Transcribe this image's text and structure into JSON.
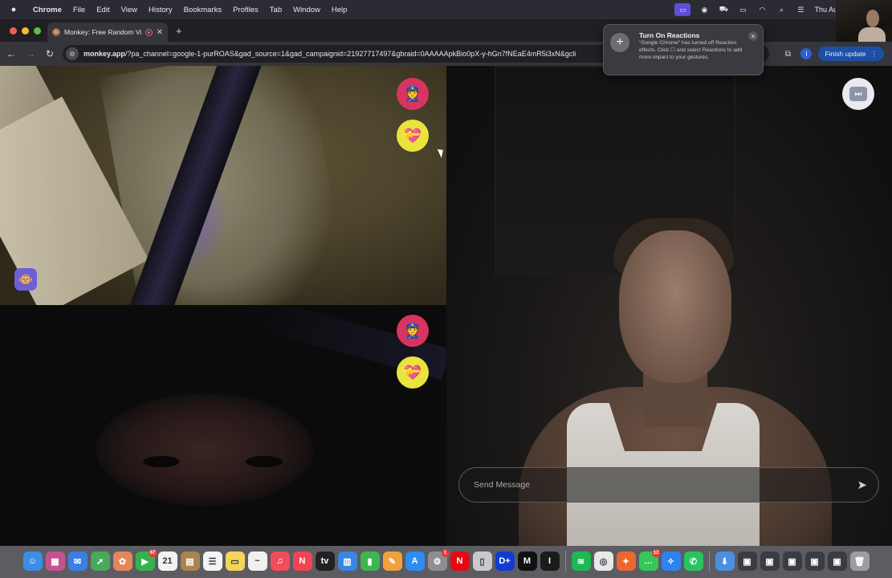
{
  "menubar": {
    "apple_icon": "apple-icon",
    "items": [
      "Chrome",
      "File",
      "Edit",
      "View",
      "History",
      "Bookmarks",
      "Profiles",
      "Tab",
      "Window",
      "Help"
    ],
    "clock": "Thu Au",
    "status_icons": [
      "screen-share-icon",
      "play-circle-icon",
      "car-icon",
      "battery-icon",
      "wifi-icon",
      "search-icon",
      "control-center-icon"
    ]
  },
  "browser": {
    "tab_title": "Monkey: Free Random Vi",
    "new_tab": "+",
    "url_domain": "monkey.app",
    "url_rest": "/?pa_channel=google-1-purROAS&gad_source=1&gad_campaignid=21927717497&gbraid=0AAAAApkBio0pX-y-hGn7fNEaE4mR5i3xN&gcli",
    "update_button": "Finish update",
    "profile_initial": "I"
  },
  "notification": {
    "title": "Turn On Reactions",
    "body": "\"Google Chrome\" has turned off Reaction effects. Click ☐ and select Reactions to add more impact to your gestures."
  },
  "page": {
    "message_placeholder": "Send Message",
    "police_emoji": "👮",
    "heart_emoji": "💝",
    "monkey_emoji": "🐵",
    "skip_emoji": "⏭"
  },
  "dock": {
    "apps": [
      {
        "name": "finder",
        "color": "#3a8ee6",
        "glyph": "☺"
      },
      {
        "name": "launchpad",
        "color": "#c6538f",
        "glyph": "▦"
      },
      {
        "name": "mail",
        "color": "#3b7fe0",
        "glyph": "✉"
      },
      {
        "name": "maps",
        "color": "#4aa85a",
        "glyph": "➚"
      },
      {
        "name": "photos",
        "color": "#e2875a",
        "glyph": "✿"
      },
      {
        "name": "facetime",
        "color": "#34b24d",
        "glyph": "▶",
        "badge": "67"
      },
      {
        "name": "calendar",
        "color": "#f2f2f2",
        "glyph": "21"
      },
      {
        "name": "notes-brown",
        "color": "#a8844f",
        "glyph": "▤"
      },
      {
        "name": "reminders",
        "color": "#f4f4f4",
        "glyph": "☰"
      },
      {
        "name": "notes",
        "color": "#f3d55b",
        "glyph": "▭"
      },
      {
        "name": "freeform",
        "color": "#f0f0f0",
        "glyph": "~"
      },
      {
        "name": "music",
        "color": "#f04c5c",
        "glyph": "♫"
      },
      {
        "name": "news",
        "color": "#f04455",
        "glyph": "N"
      },
      {
        "name": "appletv",
        "color": "#222222",
        "glyph": "tv"
      },
      {
        "name": "keynote",
        "color": "#3a86e3",
        "glyph": "▥"
      },
      {
        "name": "numbers",
        "color": "#3fb54f",
        "glyph": "▮"
      },
      {
        "name": "pages",
        "color": "#f2a13a",
        "glyph": "✎"
      },
      {
        "name": "appstore",
        "color": "#2f8cf0",
        "glyph": "A"
      },
      {
        "name": "settings",
        "color": "#8e8e93",
        "glyph": "⚙",
        "badge": "1"
      },
      {
        "name": "netflix",
        "color": "#e50914",
        "glyph": "N"
      },
      {
        "name": "iphone-mirroring",
        "color": "#c9c9cc",
        "glyph": "▯"
      },
      {
        "name": "disney",
        "color": "#113ccf",
        "glyph": "D+"
      },
      {
        "name": "medium",
        "color": "#111111",
        "glyph": "M"
      },
      {
        "name": "cursor-app",
        "color": "#1b1b1b",
        "glyph": "I"
      },
      {
        "name": "spotify",
        "color": "#1db954",
        "glyph": "≋"
      },
      {
        "name": "chrome",
        "color": "#e8e8e8",
        "glyph": "◎"
      },
      {
        "name": "fruit-app",
        "color": "#e9682f",
        "glyph": "✦"
      },
      {
        "name": "messages",
        "color": "#35c759",
        "glyph": "…",
        "badge": "12"
      },
      {
        "name": "safari",
        "color": "#2e83ef",
        "glyph": "✧"
      },
      {
        "name": "whatsapp",
        "color": "#27c460",
        "glyph": "✆"
      },
      {
        "name": "downloads-folder",
        "color": "#4c8ee0",
        "glyph": "⬇"
      },
      {
        "name": "window-1",
        "color": "#3b3b40",
        "glyph": "▣"
      },
      {
        "name": "window-2",
        "color": "#3b3b40",
        "glyph": "▣"
      },
      {
        "name": "window-3",
        "color": "#3b3b40",
        "glyph": "▣"
      },
      {
        "name": "window-4",
        "color": "#3b3b40",
        "glyph": "▣"
      },
      {
        "name": "window-5",
        "color": "#3b3b40",
        "glyph": "▣"
      },
      {
        "name": "trash",
        "color": "#9c9ca2",
        "glyph": "🗑"
      }
    ]
  },
  "colors": {
    "police": "#d8345f",
    "heart": "#e9e43d",
    "monkey": "#6d5fd6",
    "update_button": "#1d4fa5"
  }
}
